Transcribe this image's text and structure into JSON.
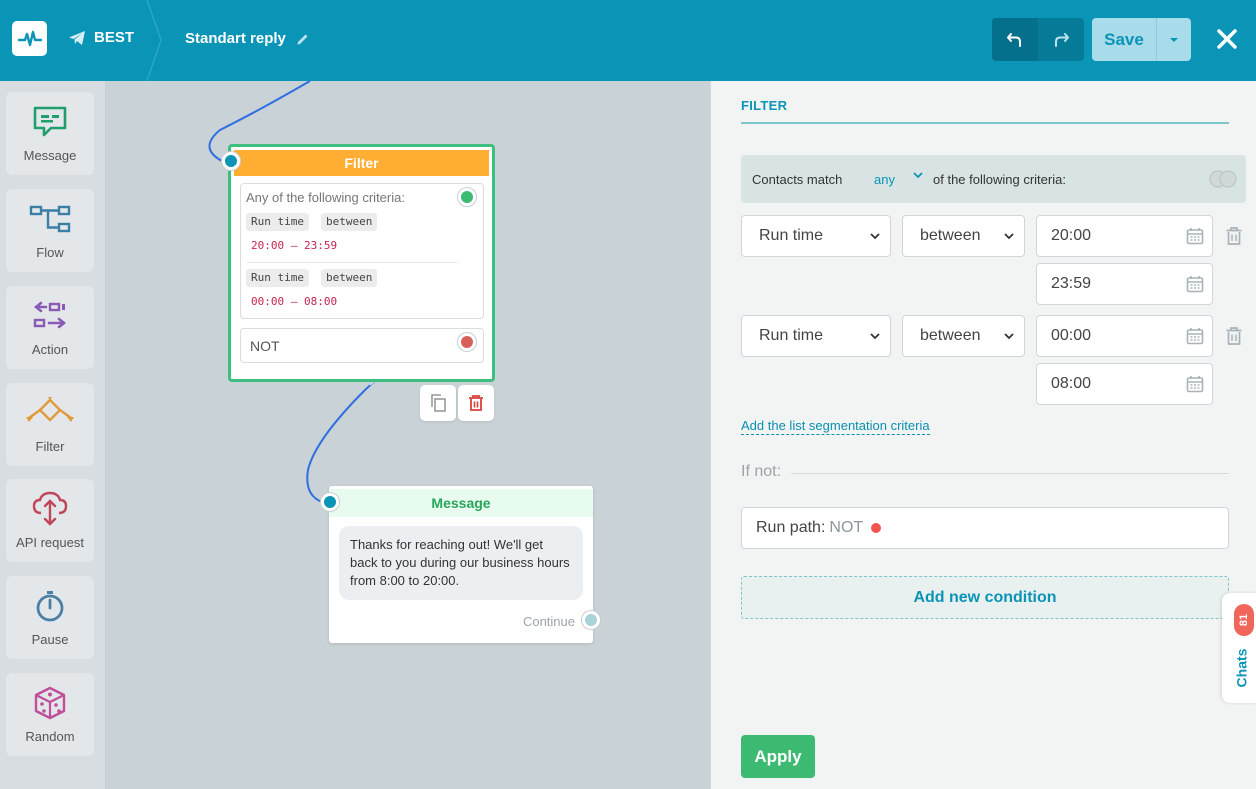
{
  "header": {
    "bot_name": "BEST",
    "flow_name": "Standart reply",
    "save_label": "Save"
  },
  "sidebar": {
    "items": [
      {
        "label": "Message",
        "icon": "message-icon",
        "color": "#1f9e6e"
      },
      {
        "label": "Flow",
        "icon": "flow-icon",
        "color": "#3b7fa6"
      },
      {
        "label": "Action",
        "icon": "action-icon",
        "color": "#8a5bb5"
      },
      {
        "label": "Filter",
        "icon": "filter-icon",
        "color": "#e19a3a"
      },
      {
        "label": "API request",
        "icon": "api-request-icon",
        "color": "#c0465c"
      },
      {
        "label": "Pause",
        "icon": "pause-timer-icon",
        "color": "#4b7fa6"
      },
      {
        "label": "Random",
        "icon": "dice-icon",
        "color": "#c04e9a"
      }
    ]
  },
  "canvas": {
    "filter_node": {
      "title": "Filter",
      "criteria_title": "Any of the following criteria:",
      "criteria": [
        {
          "field": "Run time",
          "op": "between",
          "value": "20:00 — 23:59"
        },
        {
          "field": "Run time",
          "op": "between",
          "value": "00:00 — 08:00"
        }
      ],
      "not_label": "NOT"
    },
    "message_node": {
      "title": "Message",
      "text": "Thanks for reaching out! We'll get back to you during our  business hours from 8:00 to 20:00.",
      "continue_label": "Continue"
    }
  },
  "panel": {
    "title": "FILTER",
    "match_prefix": "Contacts match",
    "match_value": "any",
    "match_suffix": "of the following criteria:",
    "conditions": [
      {
        "field": "Run time",
        "op": "between",
        "from": "20:00",
        "to": "23:59"
      },
      {
        "field": "Run time",
        "op": "between",
        "from": "00:00",
        "to": "08:00"
      }
    ],
    "add_segmentation": "Add the list segmentation criteria",
    "if_not": "If not:",
    "run_path_label": "Run path:",
    "run_path_value": "NOT",
    "add_condition": "Add new condition",
    "apply": "Apply"
  },
  "chats": {
    "label": "Chats",
    "count": "81"
  },
  "colors": {
    "brand": "#0a94b6",
    "filter_header": "#ffad33",
    "success": "#3cba72",
    "danger": "#f0554e"
  }
}
